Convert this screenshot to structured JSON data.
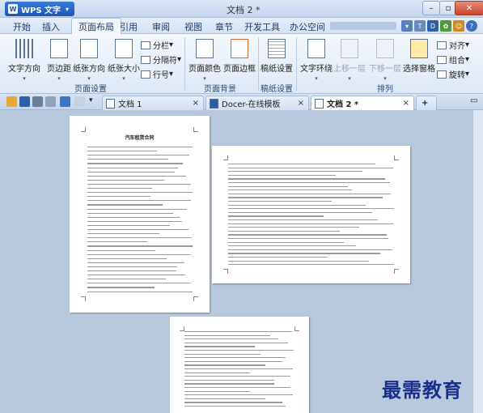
{
  "app": {
    "name": "WPS 文字",
    "doc_title": "文档 2 *"
  },
  "menu": [
    "开始",
    "插入",
    "页面布局",
    "引用",
    "审阅",
    "视图",
    "章节",
    "开发工具",
    "办公空间"
  ],
  "ribbon": {
    "big_buttons": [
      "文字方向",
      "页边距",
      "纸张方向",
      "纸张大小",
      "页面颜色",
      "页面边框",
      "稿纸设置",
      "文字环绕",
      "上移一层",
      "下移一层",
      "选择窗格"
    ],
    "small_buttons": [
      "分栏",
      "分隔符",
      "行号",
      "对齐",
      "组合",
      "旋转"
    ],
    "groups": [
      "页面设置",
      "页面背景",
      "稿纸设置",
      "排列"
    ]
  },
  "tabs": [
    {
      "label": "文档 1",
      "close": "×"
    },
    {
      "label": "Docer-在线模板",
      "close": "×"
    },
    {
      "label": "文档 2 *",
      "close": "×"
    }
  ],
  "pages": {
    "page1_title": "汽车租赁合同"
  },
  "watermark": "最需教育",
  "colors": {
    "accent": "#1c56b5",
    "workspace": "#b9c9dd"
  }
}
